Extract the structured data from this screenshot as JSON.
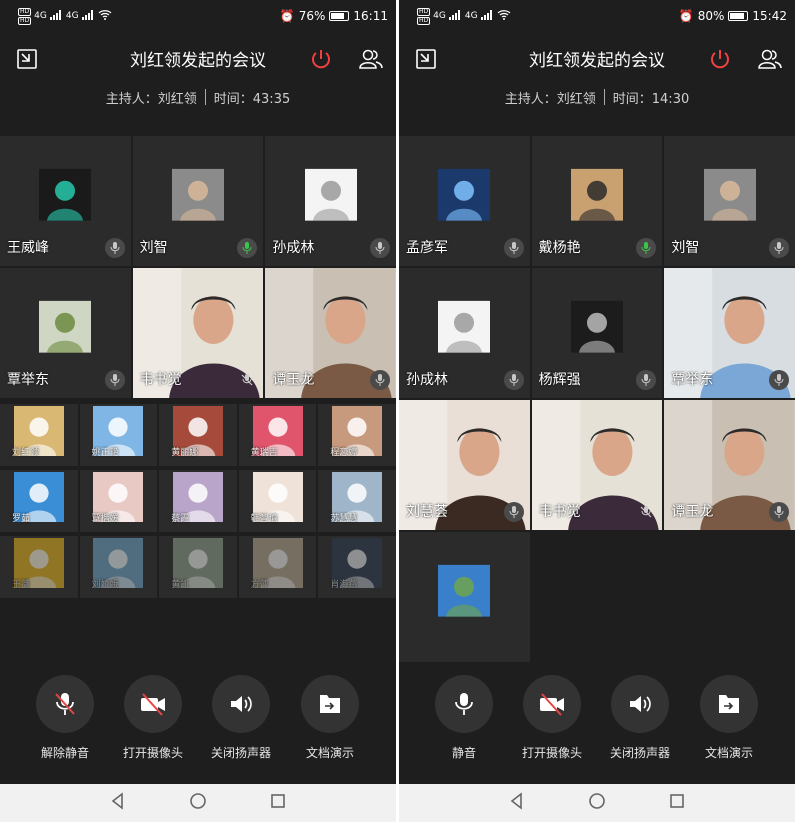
{
  "screens": [
    {
      "status": {
        "hd_top": "HD",
        "hd_bottom": "HD",
        "network": "4G",
        "alarm_glyph": "⏰",
        "battery": "76%",
        "battery_level": 0.76,
        "time": "16:11"
      },
      "title": "刘红领发起的会议",
      "host_label": "主持人：刘红领",
      "time_label": "时间：43:35",
      "big_tiles": [
        {
          "name": "王威峰",
          "mic": "muted-gray",
          "type": "avatar",
          "avatar_color": "#1a1a1a",
          "accent": "#27c9ab"
        },
        {
          "name": "刘智",
          "mic": "speaking-green",
          "type": "avatar",
          "avatar_color": "#8b8b8b",
          "accent": "#d8b89a"
        },
        {
          "name": "孙成林",
          "mic": "muted-gray",
          "type": "avatar",
          "avatar_color": "#f4f4f4",
          "accent": "#9a9a9a"
        },
        {
          "name": "覃举东",
          "mic": "muted-gray",
          "type": "avatar",
          "avatar_color": "#cfd6c4",
          "accent": "#6c8a3e"
        },
        {
          "name": "韦书觉",
          "mic": "muted-slash",
          "type": "video",
          "avatar_color": "#e6e1d6",
          "accent": "#3b2a3a"
        },
        {
          "name": "谭玉龙",
          "mic": "muted-gray",
          "type": "video",
          "avatar_color": "#c9bfb3",
          "accent": "#7a5a44"
        }
      ],
      "small_tiles": [
        {
          "name": "刘红领",
          "avatar_color": "#d9b874",
          "faded": false
        },
        {
          "name": "姚正艳",
          "avatar_color": "#7fb6e6",
          "faded": false
        },
        {
          "name": "黄丽娜",
          "avatar_color": "#a64b3c",
          "faded": false
        },
        {
          "name": "黄瑞吉",
          "avatar_color": "#e0556b",
          "faded": false
        },
        {
          "name": "程恋婷",
          "avatar_color": "#c89a7d",
          "faded": false
        },
        {
          "name": "罗茹",
          "avatar_color": "#3a8ed6",
          "faded": false
        },
        {
          "name": "覃楷媛",
          "avatar_color": "#e9c9c4",
          "faded": false
        },
        {
          "name": "蔡霞",
          "avatar_color": "#b9a5c9",
          "faded": false
        },
        {
          "name": "韩智瑜",
          "avatar_color": "#efe2d8",
          "faded": false
        },
        {
          "name": "苏慧慧",
          "avatar_color": "#9fb5c9",
          "faded": false
        },
        {
          "name": "王薇",
          "avatar_color": "#e4b320",
          "faded": true
        },
        {
          "name": "刘娇娥",
          "avatar_color": "#6da3c4",
          "faded": true
        },
        {
          "name": "黄凯",
          "avatar_color": "#8d9e88",
          "faded": true
        },
        {
          "name": "方萍",
          "avatar_color": "#b4a58c",
          "faded": true
        },
        {
          "name": "肖海燕",
          "avatar_color": "#2d3c52",
          "faded": true
        }
      ],
      "controls": [
        {
          "key": "mic",
          "label": "解除静音",
          "state": "muted"
        },
        {
          "key": "camera",
          "label": "打开摄像头",
          "state": "off"
        },
        {
          "key": "speaker",
          "label": "关闭扬声器",
          "state": "on"
        },
        {
          "key": "share",
          "label": "文档演示",
          "state": "idle"
        }
      ]
    },
    {
      "status": {
        "hd_top": "HD",
        "hd_bottom": "HD",
        "network": "4G",
        "alarm_glyph": "⏰",
        "battery": "80%",
        "battery_level": 0.8,
        "time": "15:42"
      },
      "title": "刘红领发起的会议",
      "host_label": "主持人：刘红领",
      "time_label": "时间：14:30",
      "big_tiles": [
        {
          "name": "孟彦军",
          "mic": "muted-gray",
          "type": "avatar",
          "avatar_color": "#1b3a6b",
          "accent": "#7fc2ff"
        },
        {
          "name": "戴杨艳",
          "mic": "speaking-green",
          "type": "avatar",
          "avatar_color": "#c9a070",
          "accent": "#2a2a2a"
        },
        {
          "name": "刘智",
          "mic": "muted-gray",
          "type": "avatar",
          "avatar_color": "#8b8b8b",
          "accent": "#d8b89a"
        },
        {
          "name": "孙成林",
          "mic": "muted-gray",
          "type": "avatar",
          "avatar_color": "#f4f4f4",
          "accent": "#9a9a9a"
        },
        {
          "name": "杨辉强",
          "mic": "muted-gray",
          "type": "avatar",
          "avatar_color": "#1c1c1c",
          "accent": "#bcbcbc"
        },
        {
          "name": "覃举东",
          "mic": "muted-gray",
          "type": "video",
          "avatar_color": "#d7dde0",
          "accent": "#7aa7d6"
        },
        {
          "name": "刘慧荟",
          "mic": "muted-gray",
          "type": "video",
          "avatar_color": "#e9dfd7",
          "accent": "#3a2a22"
        },
        {
          "name": "韦书觉",
          "mic": "muted-slash",
          "type": "video",
          "avatar_color": "#e6e1d6",
          "accent": "#3b2a3a"
        },
        {
          "name": "谭玉龙",
          "mic": "muted-gray",
          "type": "video",
          "avatar_color": "#c9bfb3",
          "accent": "#7a5a44"
        },
        {
          "name": "",
          "mic": "none",
          "type": "avatar",
          "avatar_color": "#3a7fc9",
          "accent": "#6fa44d"
        }
      ],
      "small_tiles": [],
      "controls": [
        {
          "key": "mic",
          "label": "静音",
          "state": "on"
        },
        {
          "key": "camera",
          "label": "打开摄像头",
          "state": "off"
        },
        {
          "key": "speaker",
          "label": "关闭扬声器",
          "state": "on"
        },
        {
          "key": "share",
          "label": "文档演示",
          "state": "idle"
        }
      ]
    }
  ]
}
